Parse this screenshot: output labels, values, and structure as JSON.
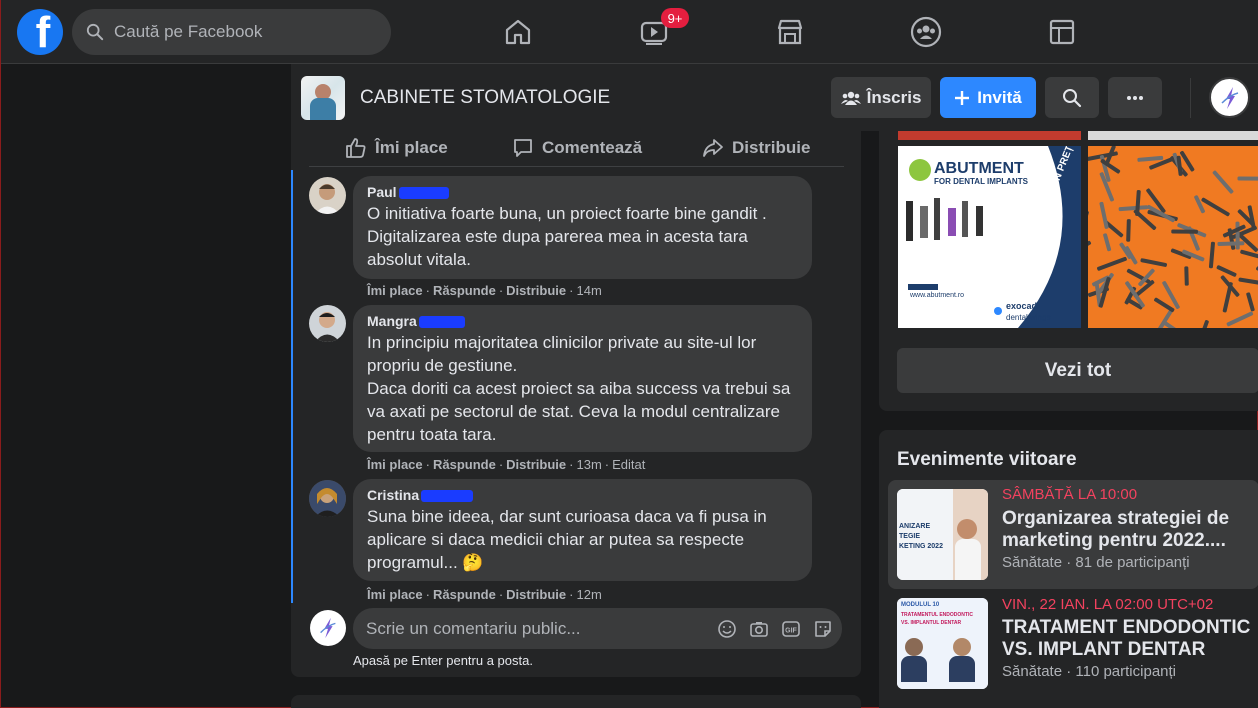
{
  "topbar": {
    "logo_letter": "f",
    "search_placeholder": "Caută pe Facebook",
    "nav": [
      "home-icon",
      "watch-icon",
      "marketplace-icon",
      "groups-icon",
      "gaming-icon"
    ],
    "watch_badge": "9+"
  },
  "group": {
    "title": "CABINETE STOMATOLOGIE",
    "joined_label": "Înscris",
    "invite_label": "Invită"
  },
  "post_actions": {
    "like": "Îmi place",
    "comment": "Comentează",
    "share": "Distribuie"
  },
  "comments": [
    {
      "name": "Paul",
      "lines": [
        "O initiativa foarte buna, un proiect foarte bine gandit .",
        "Digitalizarea este dupa parerea mea in acesta tara",
        "absolut vitala."
      ],
      "like": "Îmi place",
      "reply": "Răspunde",
      "share": "Distribuie",
      "time": "14m",
      "edited": ""
    },
    {
      "name": "Mangra",
      "lines": [
        "In principiu majoritatea clinicilor private au site-ul lor",
        "propriu de gestiune.",
        "Daca doriti ca acest proiect sa aiba success va trebui sa",
        "va axati pe sectorul de stat. Ceva la modul centralizare",
        "pentru toata tara."
      ],
      "like": "Îmi place",
      "reply": "Răspunde",
      "share": "Distribuie",
      "time": "13m",
      "edited": "Editat"
    },
    {
      "name": "Cristina",
      "lines": [
        "Suna bine ideea, dar sunt curioasa daca va fi pusa in",
        "aplicare si daca medicii chiar ar putea sa respecte",
        "programul... 🤔"
      ],
      "like": "Îmi place",
      "reply": "Răspunde",
      "share": "Distribuie",
      "time": "12m",
      "edited": ""
    }
  ],
  "reply": {
    "placeholder": "Scrie un comentariu public...",
    "hint": "Apasă pe Enter pentru a posta."
  },
  "media": {
    "photo1_heading": "ABUTMENT",
    "photo1_sub": "FOR DENTAL IMPLANTS",
    "photo1_slogan": "CEL MAI BUN PREȚ",
    "photo1_brand1": "exocad",
    "photo1_brand2": "dental wings",
    "photo1_url": "www.abutment.ro",
    "see_all": "Vezi tot"
  },
  "events": {
    "heading": "Evenimente viitoare",
    "items": [
      {
        "date": "SÂMBĂTĂ LA 10:00",
        "title_line1": "Organizarea strategiei de",
        "title_line2": "marketing pentru 2022....",
        "sub": "Sănătate · 81 de participanți",
        "thumb_text1": "ANIZARE",
        "thumb_text2": "TEGIE",
        "thumb_text3": "KETING 2022"
      },
      {
        "date": "VIN., 22 IAN. LA 02:00 UTC+02",
        "title_line1": "TRATAMENT ENDODONTIC",
        "title_line2": "VS. IMPLANT DENTAR",
        "sub": "Sănătate · 110 participanți",
        "thumb_text1": "MODULUL 10",
        "thumb_text2": "TRATAMENTUL ENDODONTIC",
        "thumb_text3": "VS. IMPLANTUL DENTAR"
      }
    ]
  },
  "colors": {
    "accent": "#2d88ff",
    "bg": "#18191a",
    "card": "#242526",
    "bubble": "#3a3b3c",
    "event_date": "#f3425f",
    "badge": "#e41e3f"
  }
}
